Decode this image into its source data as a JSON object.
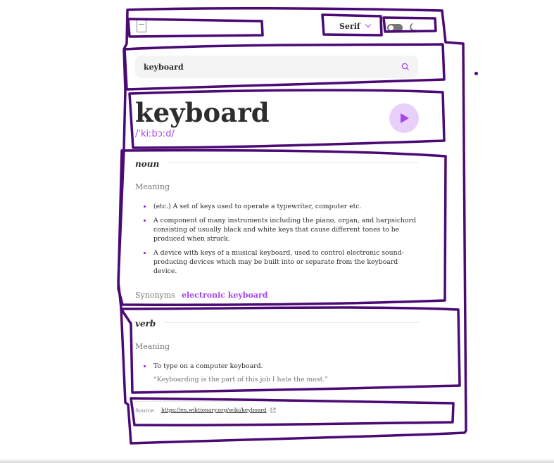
{
  "header": {
    "logo_icon": "book-icon",
    "font_label": "Serif",
    "theme_icon": "moon-icon"
  },
  "search": {
    "value": "keyboard",
    "icon": "search-icon"
  },
  "entry": {
    "word": "keyboard",
    "phonetic": "/ˈkiːbɔːd/",
    "play_icon": "play-icon"
  },
  "meanings": [
    {
      "part_of_speech": "noun",
      "label": "Meaning",
      "definitions": [
        "(etc.) A set of keys used to operate a typewriter, computer etc.",
        "A component of many instruments including the piano, organ, and harpsichord consisting of usually black and white keys that cause different tones to be produced when struck.",
        "A device with keys of a musical keyboard, used to control electronic sound-producing devices which may be built into or separate from the keyboard device."
      ],
      "synonyms_label": "Synonyms",
      "synonyms": [
        "electronic keyboard"
      ]
    },
    {
      "part_of_speech": "verb",
      "label": "Meaning",
      "definitions": [
        "To type on a computer keyboard."
      ],
      "example": "“Keyboarding is the part of this job I hate the most.”"
    }
  ],
  "source": {
    "label": "Source",
    "url": "https://en.wiktionary.org/wiki/keyboard",
    "icon": "external-link-icon"
  },
  "colors": {
    "accent": "#a445ed",
    "play_bg": "#e9d0fa",
    "annotation": "#4b0a74"
  }
}
